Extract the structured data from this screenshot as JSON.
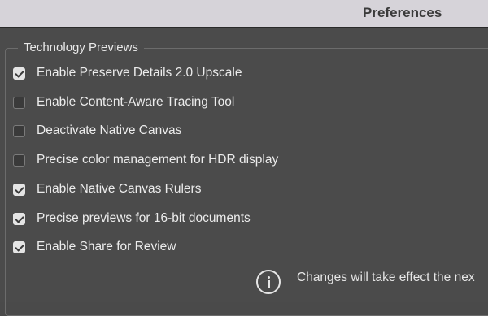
{
  "window": {
    "title": "Preferences"
  },
  "group": {
    "title": "Technology Previews"
  },
  "options": [
    {
      "label": "Enable Preserve Details 2.0 Upscale",
      "checked": true
    },
    {
      "label": "Enable Content-Aware Tracing Tool",
      "checked": false
    },
    {
      "label": "Deactivate Native Canvas",
      "checked": false
    },
    {
      "label": "Precise color management for HDR display",
      "checked": false
    },
    {
      "label": "Enable Native Canvas Rulers",
      "checked": true
    },
    {
      "label": "Precise previews for 16-bit documents",
      "checked": true
    },
    {
      "label": "Enable Share for Review",
      "checked": true
    }
  ],
  "info": {
    "icon": "info-icon",
    "text": "Changes will take effect the nex"
  },
  "colors": {
    "titlebar": "#d6d3d9",
    "panel": "#4b4b4b",
    "text": "#ececec"
  }
}
